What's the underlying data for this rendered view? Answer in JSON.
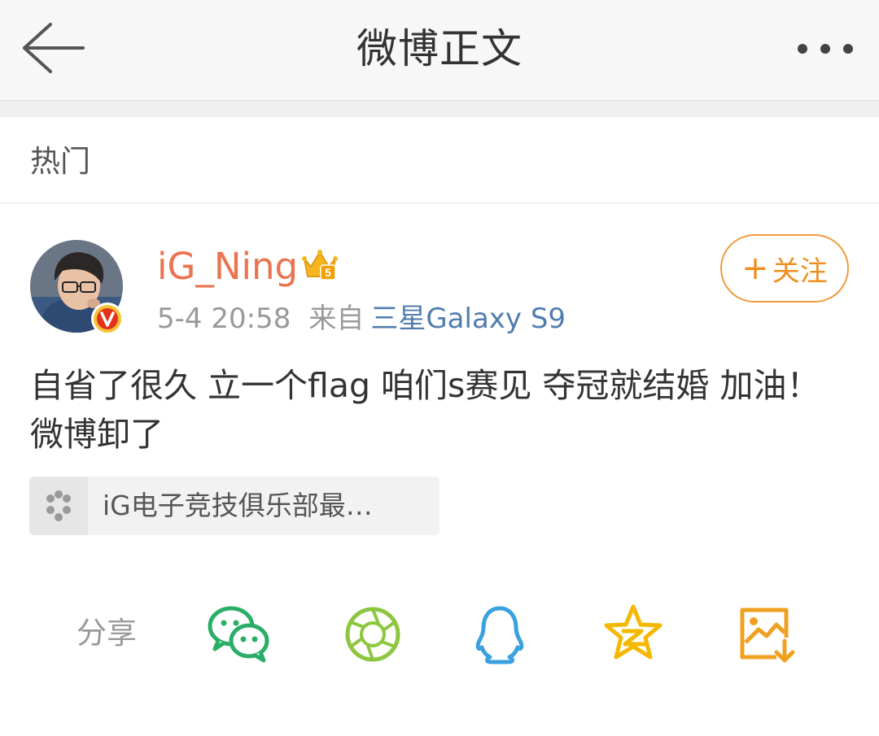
{
  "header": {
    "title": "微博正文",
    "back_icon": "back-arrow-icon",
    "more_icon": "more-dots-icon"
  },
  "hot_bar": {
    "label": "热门"
  },
  "post": {
    "username": "iG_Ning",
    "time": "5-4 20:58",
    "source_prefix": "来自",
    "device": "三星Galaxy S9",
    "follow_label": "关注",
    "text": "自省了很久 立一个flag 咱们s赛见 夺冠就结婚 加油！ 微博卸了",
    "link_card": {
      "text": "iG电子竞技俱乐部最…"
    }
  },
  "share": {
    "label": "分享",
    "targets": [
      "wechat-icon",
      "moments-icon",
      "qq-icon",
      "qzone-icon",
      "save-image-icon"
    ]
  },
  "colors": {
    "accent_orange": "#f08e1e",
    "username": "#eb7350",
    "link_blue": "#507daf",
    "wechat_green": "#2aae67",
    "moments_green": "#8dc63f",
    "qq_blue": "#3aa1e0",
    "qzone_yellow": "#f5b800",
    "save_orange": "#f0a020"
  }
}
